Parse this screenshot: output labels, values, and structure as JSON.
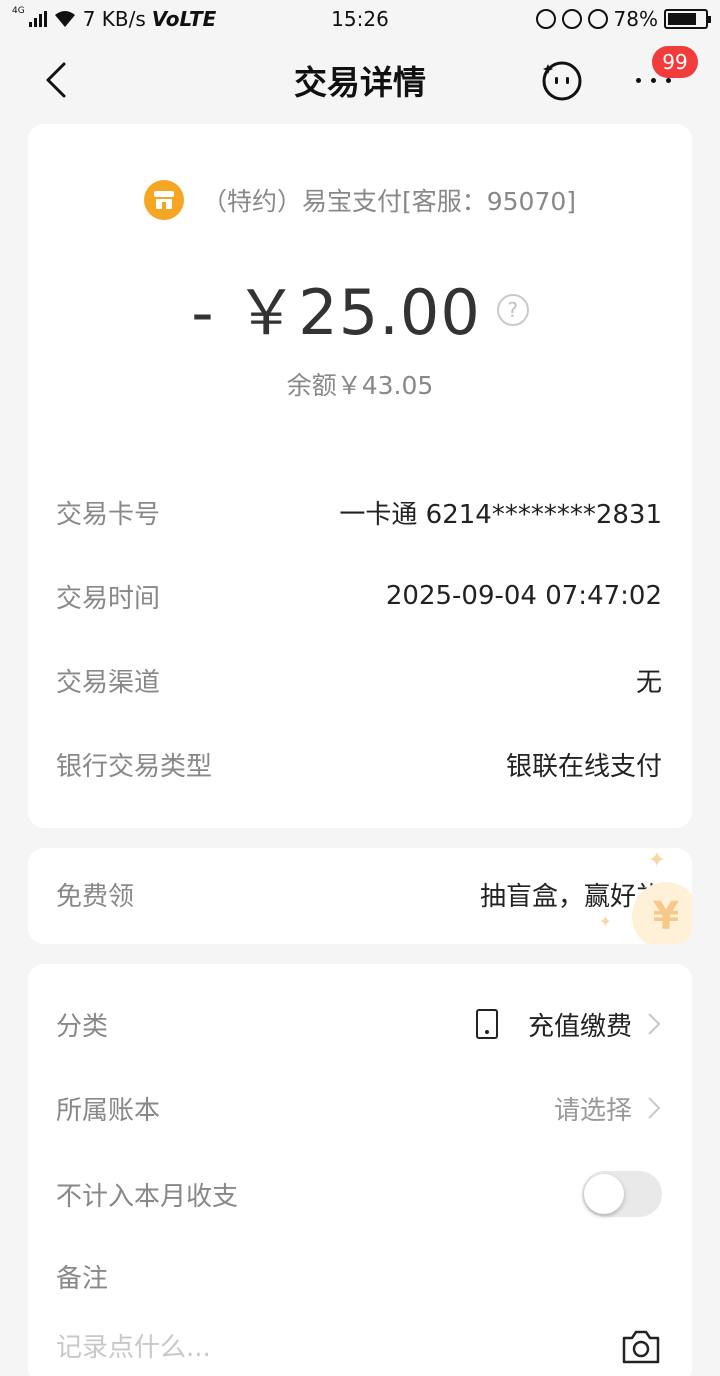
{
  "status_bar": {
    "network": "4G",
    "speed": "7 KB/s",
    "volte": "VoLTE",
    "time": "15:26",
    "battery": "78%",
    "battery_level": 0.78
  },
  "header": {
    "title": "交易详情",
    "badge_count": "99"
  },
  "transaction": {
    "merchant": "（特约）易宝支付[客服：95070]",
    "amount": "- ￥25.00",
    "help_mark": "?",
    "balance": "余额￥43.05",
    "details": [
      {
        "label": "交易卡号",
        "value": "一卡通 6214********2831"
      },
      {
        "label": "交易时间",
        "value": "2025-09-04 07:47:02"
      },
      {
        "label": "交易渠道",
        "value": "无"
      },
      {
        "label": "银行交易类型",
        "value": "银联在线支付"
      }
    ]
  },
  "promo": {
    "label": "免费领",
    "value": "抽盲盒，赢好礼",
    "deco_symbol": "¥"
  },
  "settings": {
    "category_label": "分类",
    "category_value": "充值缴费",
    "account_book_label": "所属账本",
    "account_book_value": "请选择",
    "exclude_label": "不计入本月收支",
    "exclude_enabled": false,
    "note_label": "备注",
    "note_placeholder": "记录点什么..."
  },
  "colors": {
    "background": "#f5f5f5",
    "merchant_icon": "#f5a623",
    "badge": "#f23b3b"
  }
}
